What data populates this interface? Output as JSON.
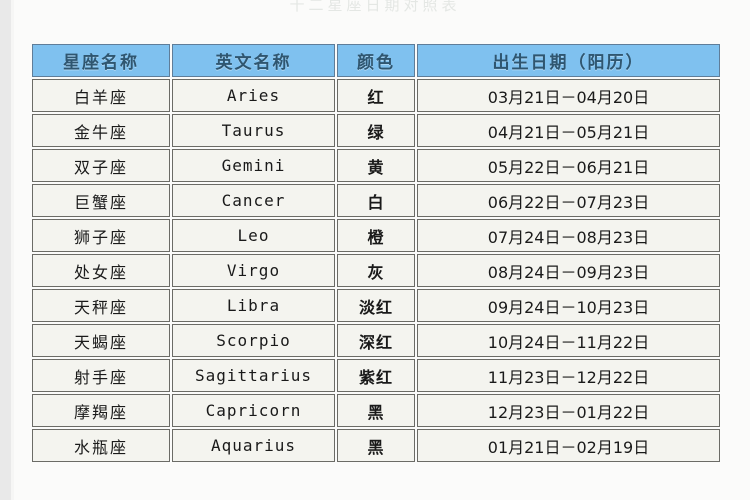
{
  "page": {
    "clipped_title": "十二星座日期对照表"
  },
  "table": {
    "headers": [
      "星座名称",
      "英文名称",
      "颜色",
      "出生日期（阳历）"
    ],
    "rows": [
      {
        "name": "白羊座",
        "english": "Aries",
        "color": "红",
        "dates": "03月21日－04月20日"
      },
      {
        "name": "金牛座",
        "english": "Taurus",
        "color": "绿",
        "dates": "04月21日－05月21日"
      },
      {
        "name": "双子座",
        "english": "Gemini",
        "color": "黄",
        "dates": "05月22日－06月21日"
      },
      {
        "name": "巨蟹座",
        "english": "Cancer",
        "color": "白",
        "dates": "06月22日－07月23日"
      },
      {
        "name": "狮子座",
        "english": "Leo",
        "color": "橙",
        "dates": "07月24日－08月23日"
      },
      {
        "name": "处女座",
        "english": "Virgo",
        "color": "灰",
        "dates": "08月24日－09月23日"
      },
      {
        "name": "天秤座",
        "english": "Libra",
        "color": "淡红",
        "dates": "09月24日－10月23日"
      },
      {
        "name": "天蝎座",
        "english": "Scorpio",
        "color": "深红",
        "dates": "10月24日－11月22日"
      },
      {
        "name": "射手座",
        "english": "Sagittarius",
        "color": "紫红",
        "dates": "11月23日－12月22日"
      },
      {
        "name": "摩羯座",
        "english": "Capricorn",
        "color": "黑",
        "dates": "12月23日－01月22日"
      },
      {
        "name": "水瓶座",
        "english": "Aquarius",
        "color": "黑",
        "dates": "01月21日－02月19日"
      }
    ]
  },
  "colors": {
    "header_background": "#7fc1ef",
    "header_text": "#2f5670",
    "header_border": "#5f7d99",
    "cell_background": "#f4f4ef",
    "cell_border": "#6b6b66",
    "cell_text": "#1a1a1a",
    "page_background": "#fbfbfa"
  }
}
